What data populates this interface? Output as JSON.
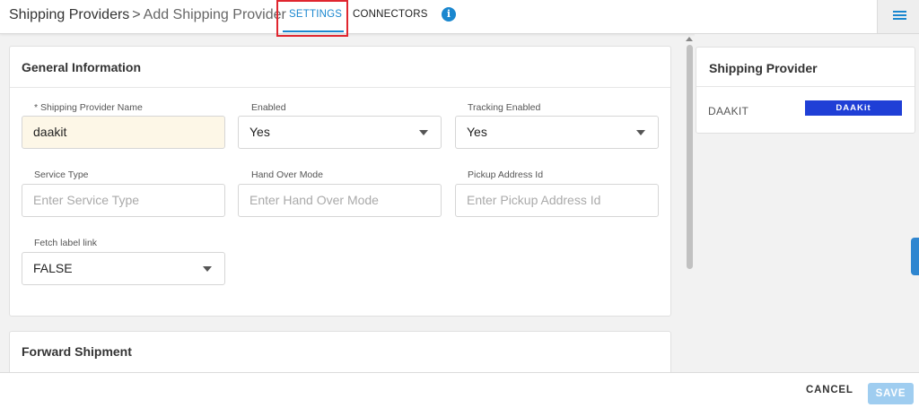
{
  "header": {
    "breadcrumb_parent": "Shipping Providers",
    "breadcrumb_separator": ">",
    "breadcrumb_current": "Add Shipping Provider",
    "tabs": [
      {
        "label": "SETTINGS",
        "active": true
      },
      {
        "label": "CONNECTORS",
        "active": false
      }
    ],
    "info_icon_glyph": "i",
    "accent_color": "#1a87cf"
  },
  "general": {
    "title": "General Information",
    "fields": {
      "provider_name": {
        "label": "*  Shipping Provider Name",
        "value": "daakit"
      },
      "enabled": {
        "label": "Enabled",
        "value": "Yes"
      },
      "tracking_enabled": {
        "label": "Tracking Enabled",
        "value": "Yes"
      },
      "service_type": {
        "label": "Service Type",
        "placeholder": "Enter Service Type"
      },
      "hand_over_mode": {
        "label": "Hand Over Mode",
        "placeholder": "Enter Hand Over Mode"
      },
      "pickup_address_id": {
        "label": "Pickup Address Id",
        "placeholder": "Enter Pickup Address Id"
      },
      "fetch_label_link": {
        "label": "Fetch label link",
        "value": "FALSE"
      }
    }
  },
  "forward": {
    "title": "Forward Shipment"
  },
  "side_panel": {
    "title": "Shipping Provider",
    "provider_name": "DAAKIT",
    "logo_text": "DAAKit"
  },
  "footer": {
    "cancel_label": "CANCEL",
    "save_label": "SAVE"
  }
}
